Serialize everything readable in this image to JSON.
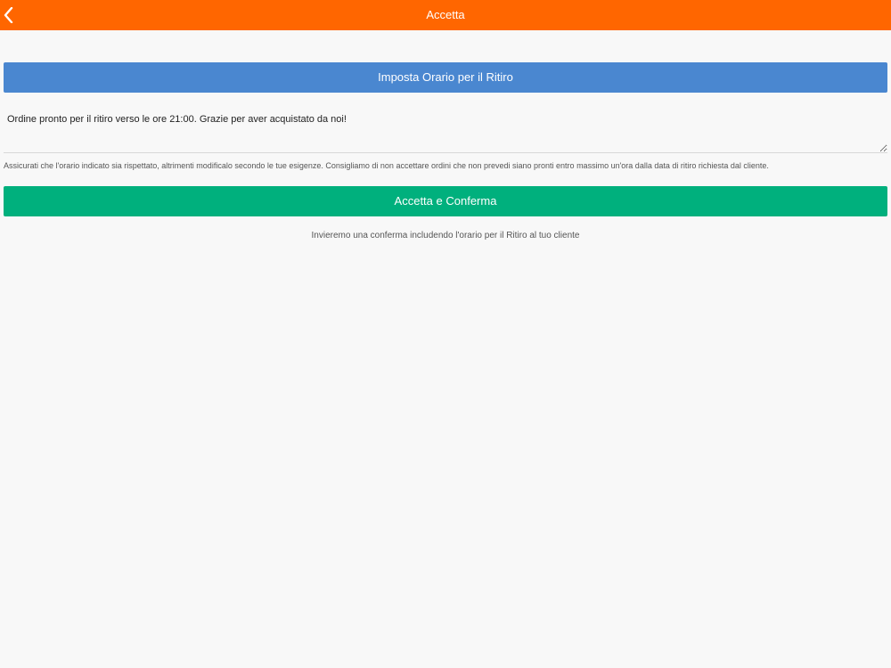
{
  "header": {
    "title": "Accetta",
    "back_icon": "chevron-left-icon",
    "background_color": "#ff6600"
  },
  "pickup_time_button": {
    "label": "Imposta Orario per il Ritiro",
    "color": "#4a87d0"
  },
  "message": {
    "value": "Ordine pronto per il ritiro verso le ore 21:00. Grazie per aver acquistato da noi!"
  },
  "hint_text": "Assicurati che l'orario indicato sia rispettato, altrimenti modificalo secondo le tue esigenze. Consigliamo di non accettare ordini che non prevedi siano pronti entro massimo un'ora dalla data di ritiro richiesta dal cliente.",
  "confirm_button": {
    "label": "Accetta e Conferma",
    "color": "#00b07d"
  },
  "confirm_note": "Invieremo una conferma includendo l'orario per il Ritiro al tuo cliente"
}
